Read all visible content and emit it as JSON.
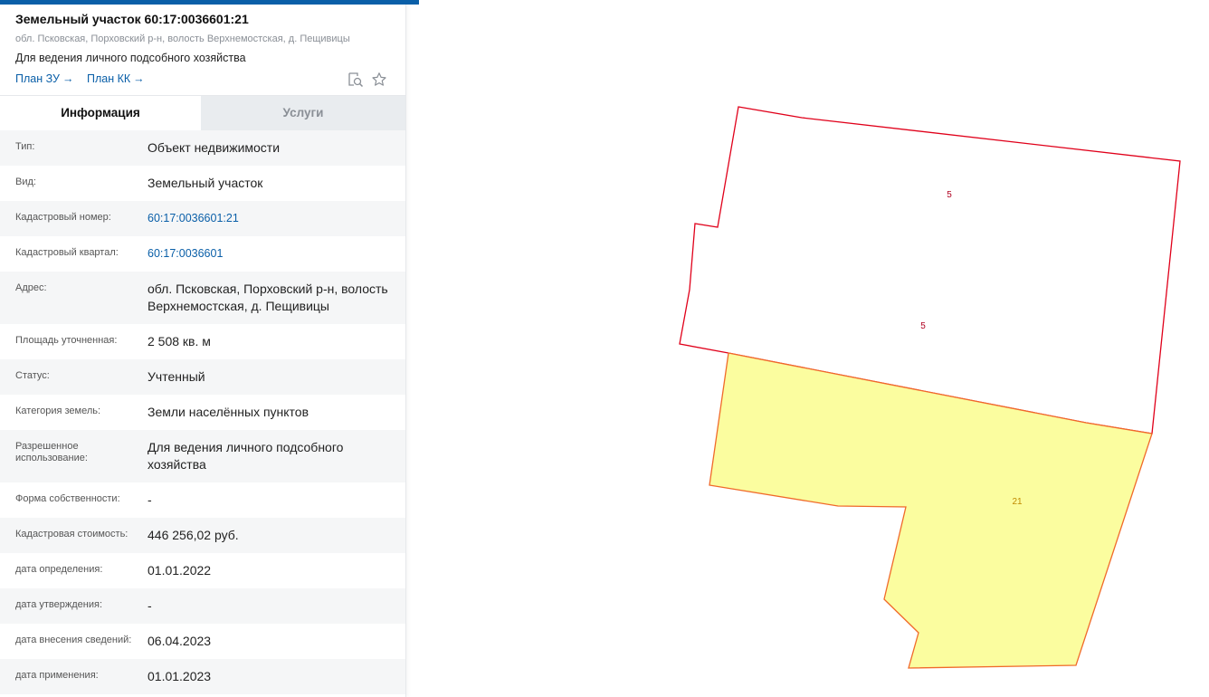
{
  "header": {
    "title": "Земельный участок 60:17:0036601:21",
    "address": "обл. Псковская, Порховский р-н, волость Верхнемостская, д. Пещивицы",
    "purpose": "Для ведения личного подсобного хозяйства",
    "links": [
      {
        "label": "План ЗУ",
        "arrow": "→"
      },
      {
        "label": "План КК",
        "arrow": "→"
      }
    ],
    "icons": [
      "search-document-icon",
      "star-icon"
    ]
  },
  "tabs": [
    {
      "label": "Информация",
      "active": true
    },
    {
      "label": "Услуги",
      "active": false
    }
  ],
  "info_rows": [
    {
      "label": "Тип:",
      "value": "Объект недвижимости",
      "is_link": false
    },
    {
      "label": "Вид:",
      "value": "Земельный участок",
      "is_link": false
    },
    {
      "label": "Кадастровый номер:",
      "value": "60:17:0036601:21",
      "is_link": true
    },
    {
      "label": "Кадастровый квартал:",
      "value": "60:17:0036601",
      "is_link": true
    },
    {
      "label": "Адрес:",
      "value": "обл. Псковская, Порховский р-н, волость Верхнемостская, д. Пещивицы",
      "is_link": false
    },
    {
      "label": "Площадь уточненная:",
      "value": "2 508 кв. м",
      "is_link": false
    },
    {
      "label": "Статус:",
      "value": "Учтенный",
      "is_link": false
    },
    {
      "label": "Категория земель:",
      "value": "Земли населённых пунктов",
      "is_link": false
    },
    {
      "label": "Разрешенное использование:",
      "value": "Для ведения личного подсобного хозяйства",
      "is_link": false
    },
    {
      "label": "Форма собственности:",
      "value": "-",
      "is_link": false
    },
    {
      "label": "Кадастровая стоимость:",
      "value": "446 256,02 руб.",
      "is_link": false
    },
    {
      "label": "дата определения:",
      "value": "01.01.2022",
      "is_link": false
    },
    {
      "label": "дата утверждения:",
      "value": "-",
      "is_link": false
    },
    {
      "label": "дата внесения сведений:",
      "value": "06.04.2023",
      "is_link": false
    },
    {
      "label": "дата применения:",
      "value": "01.01.2023",
      "is_link": false
    }
  ],
  "map": {
    "labels": {
      "parcel_5_upper": "5",
      "parcel_5_lower": "5",
      "parcel_21": "21"
    },
    "colors": {
      "border": "#e0001a",
      "selected_fill": "#fbfd9f",
      "label_red": "#b00020",
      "label_selected": "#c08a00",
      "accent": "#0a5fa8"
    }
  }
}
